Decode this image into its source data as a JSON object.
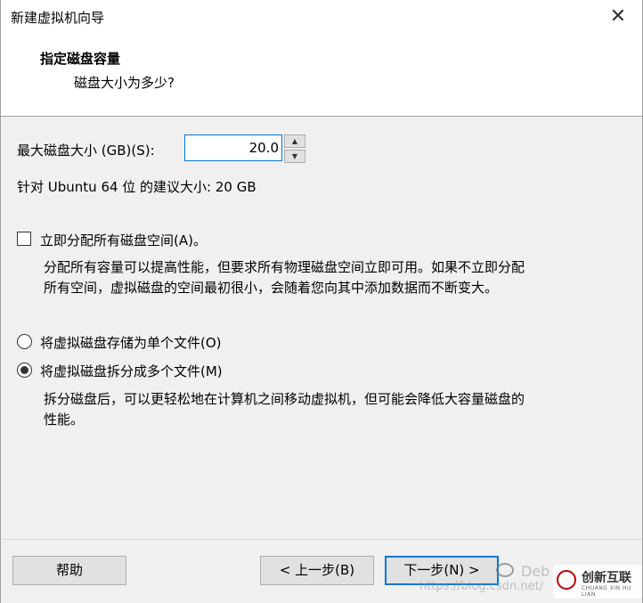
{
  "window": {
    "title": "新建虚拟机向导",
    "close_glyph": "✕"
  },
  "header": {
    "title": "指定磁盘容量",
    "subtitle": "磁盘大小为多少?"
  },
  "disk_size": {
    "label": "最大磁盘大小 (GB)(S):",
    "value": "20.0",
    "up_glyph": "▲",
    "down_glyph": "▼"
  },
  "recommendation": "针对 Ubuntu 64 位 的建议大小: 20 GB",
  "allocate": {
    "checked": false,
    "label": "立即分配所有磁盘空间(A)。",
    "description_line1": "分配所有容量可以提高性能，但要求所有物理磁盘空间立即可用。如果不立即分配",
    "description_line2": "所有空间，虚拟磁盘的空间最初很小，会随着您向其中添加数据而不断变大。"
  },
  "storage_options": {
    "single_file_label": "将虚拟磁盘存储为单个文件(O)",
    "multi_file_label": "将虚拟磁盘拆分成多个文件(M)",
    "selected": "multi",
    "multi_description_line1": "拆分磁盘后，可以更轻松地在计算机之间移动虚拟机，但可能会降低大容量磁盘的",
    "multi_description_line2": "性能。"
  },
  "buttons": {
    "help": "帮助",
    "back": "< 上一步(B)",
    "next": "下一步(N) >"
  },
  "watermark": {
    "debian_text": "Deb",
    "url_text": "https://blog.csdn.net/",
    "logo_name": "创新互联",
    "logo_sub": "CHUANG XIN HU LIAN"
  }
}
